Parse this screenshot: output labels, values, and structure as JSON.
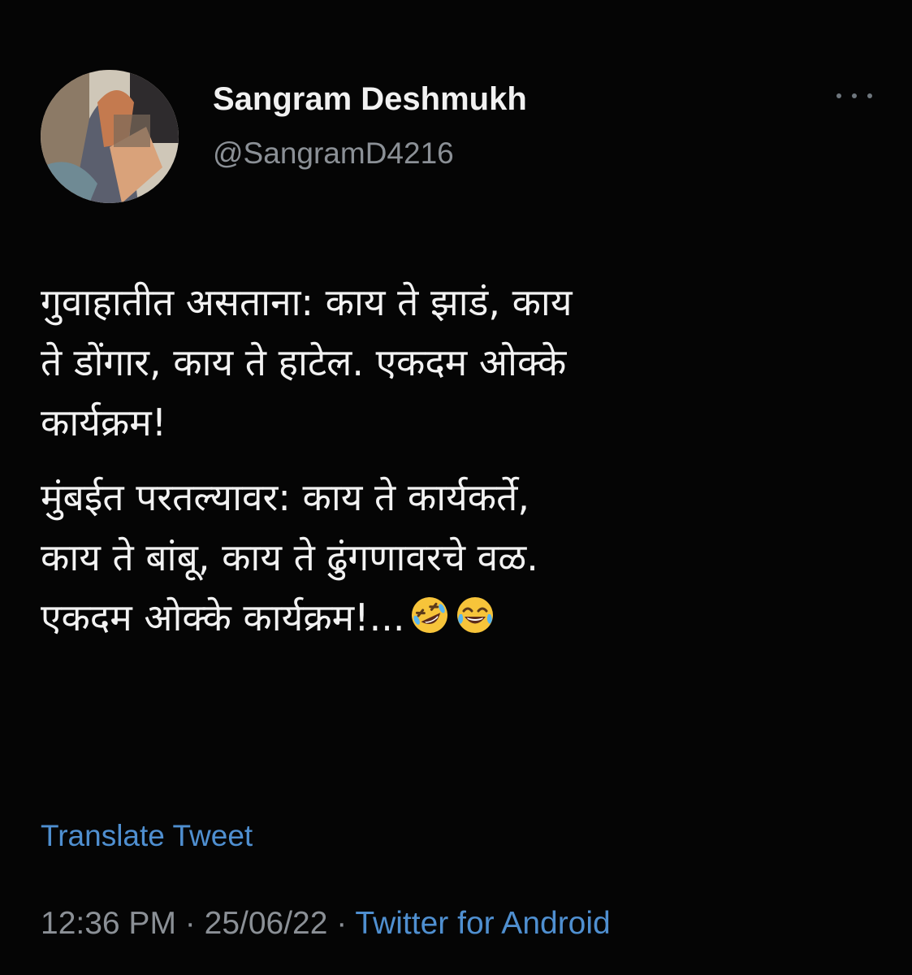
{
  "tweet": {
    "author_name": "Sangram Deshmukh",
    "author_handle": "@SangramD4216",
    "paragraph_1": "गुवाहातीत असताना: काय ते झाडं, काय\nते डोंगार, काय ते हाटेल. एकदम ओक्के\nकार्यक्रम!",
    "paragraph_2": "मुंबईत परतल्यावर: काय ते कार्यकर्ते,\nकाय ते बांबू, काय ते ढुंगणावरचे वळ.\nएकदम ओक्के कार्यक्रम!...",
    "emojis": [
      "rolling-on-floor-laughing",
      "tears-of-joy"
    ],
    "translate_label": "Translate Tweet",
    "time": "12:36 PM",
    "separator": "·",
    "date": "25/06/22",
    "source": "Twitter for Android"
  },
  "colors": {
    "background": "#050505",
    "text": "#f2f2f2",
    "secondary": "#8b9096",
    "link": "#4f8fd0"
  }
}
